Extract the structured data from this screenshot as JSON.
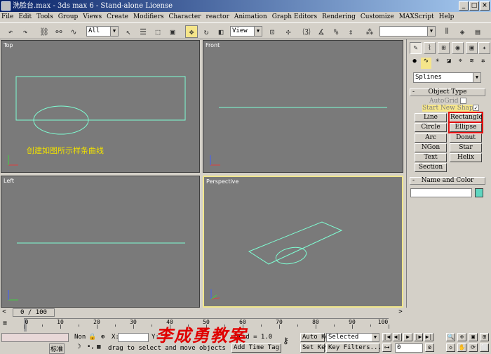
{
  "window": {
    "title": "洗脸台.max - 3ds max 6 - Stand-alone License",
    "buttons": [
      "_",
      "□",
      "×"
    ]
  },
  "menu": [
    "File",
    "Edit",
    "Tools",
    "Group",
    "Views",
    "Create",
    "Modifiers",
    "Character",
    "reactor",
    "Animation",
    "Graph Editors",
    "Rendering",
    "Customize",
    "MAXScript",
    "Help"
  ],
  "toolbar": {
    "selection_filter": "All",
    "ref_coord": "View"
  },
  "viewports": {
    "top": {
      "label": "Top",
      "annotation": "创建如图所示样条曲线"
    },
    "front": {
      "label": "Front"
    },
    "left": {
      "label": "Left"
    },
    "perspective": {
      "label": "Perspective"
    }
  },
  "command_panel": {
    "category_dropdown": "Splines",
    "object_type": {
      "header": "Object Type",
      "autogrid": "AutoGrid",
      "start_new_shape": "Start New Shape",
      "buttons": [
        "Line",
        "Rectangle",
        "Circle",
        "Ellipse",
        "Arc",
        "Donut",
        "NGon",
        "Star",
        "Text",
        "Helix",
        "Section"
      ]
    },
    "name_and_color": {
      "header": "Name and Color"
    },
    "colors": {
      "spline": "#7fffd4",
      "swatch": "#5fd6c0",
      "highlight": "#e01010"
    }
  },
  "timeline": {
    "frame_counter": "0 / 100",
    "ticks": [
      "0",
      "10",
      "20",
      "30",
      "40",
      "50",
      "60",
      "70",
      "80",
      "90",
      "100"
    ]
  },
  "status": {
    "none_sel": "Non",
    "x_label": "X:",
    "y_label": "Y:",
    "grid": "Grid = 1.0",
    "prompt": "drag to select and move objects",
    "add_time_tag": "Add Time Tag",
    "auto_key": "Auto Key",
    "set_key": "Set Key",
    "key_mode": "Selected",
    "key_filters": "Key Filters...",
    "ime": "标准",
    "frame_field": "0",
    "watermark": "李成勇教案"
  }
}
